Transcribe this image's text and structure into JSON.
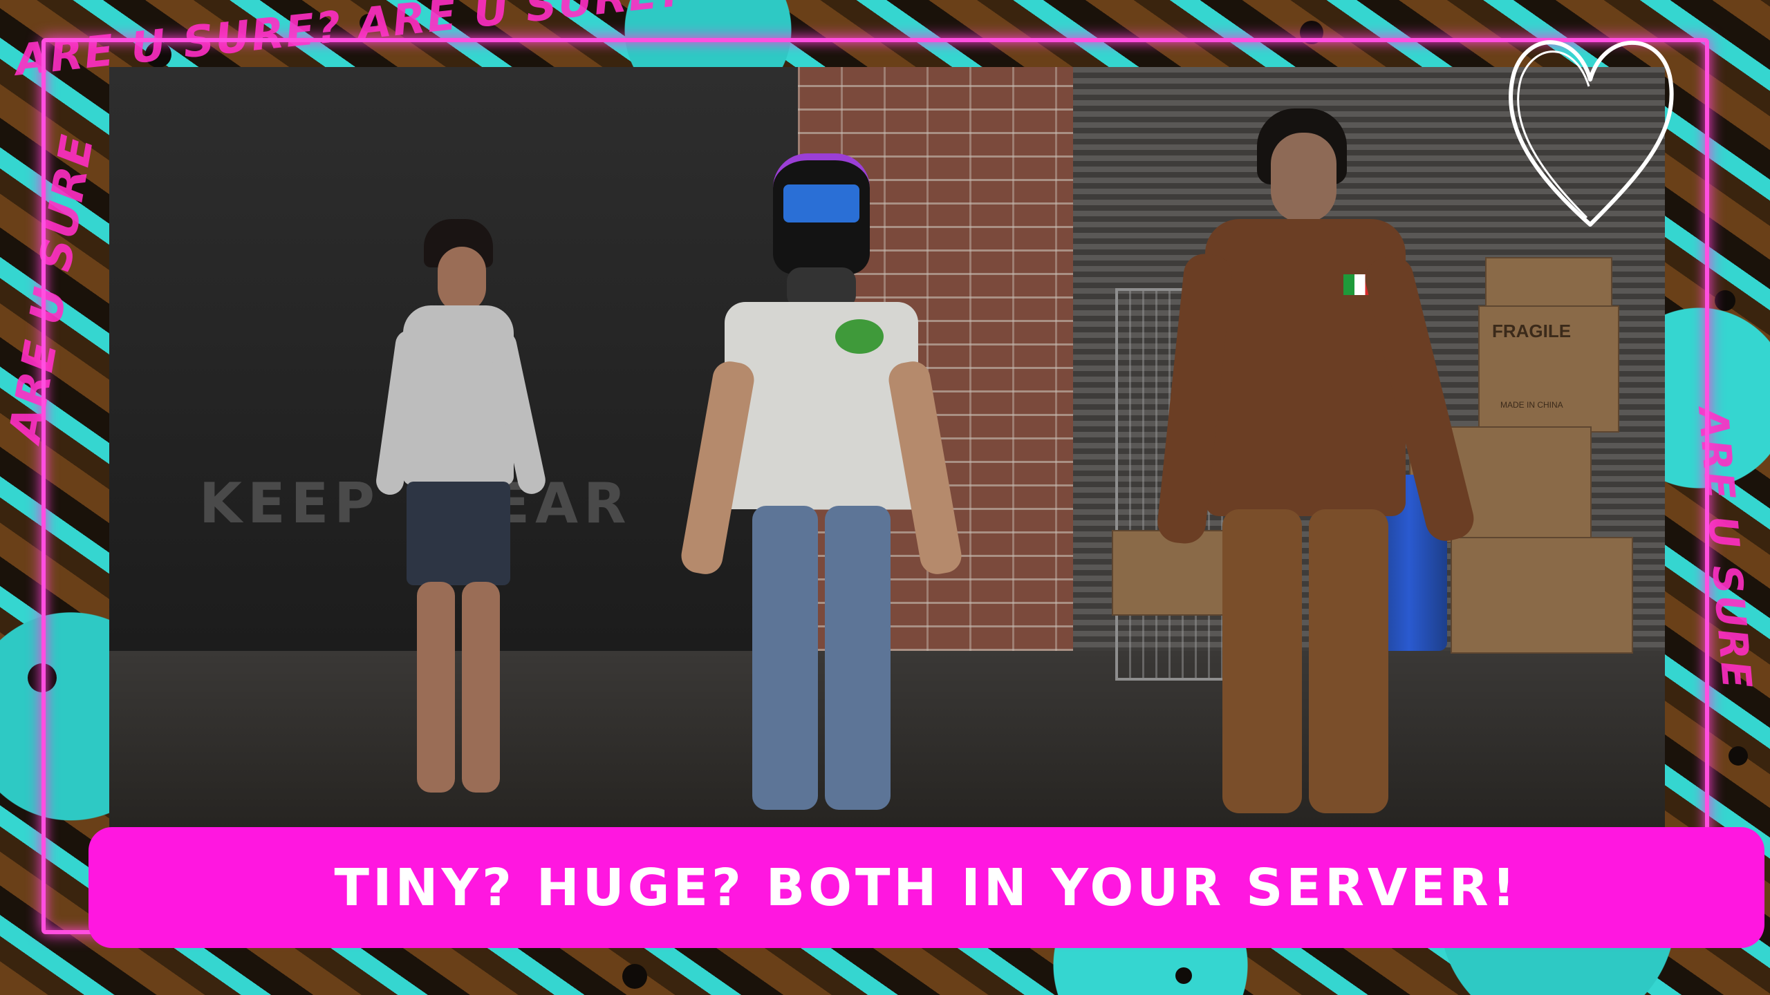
{
  "banner": {
    "text": "TINY? HUGE? BOTH IN YOUR SERVER!"
  },
  "scene": {
    "wall_text": "KEEP CLEAR",
    "box_label": "FRAGILE",
    "box_label_small": "MADE IN CHINA"
  },
  "graffiti": {
    "top": "ARE U SURE? ARE U SURE?",
    "left": "ARE U SURE",
    "right": "ARE U SURE"
  },
  "icons": [
    "heart-doodle-icon",
    "frog-patch-icon",
    "italy-flag-icon"
  ],
  "colors": {
    "accent_magenta": "#ff17e0",
    "neon_glow": "#ff4fe0",
    "teal": "#35d6d0",
    "brown": "#6a4018"
  }
}
